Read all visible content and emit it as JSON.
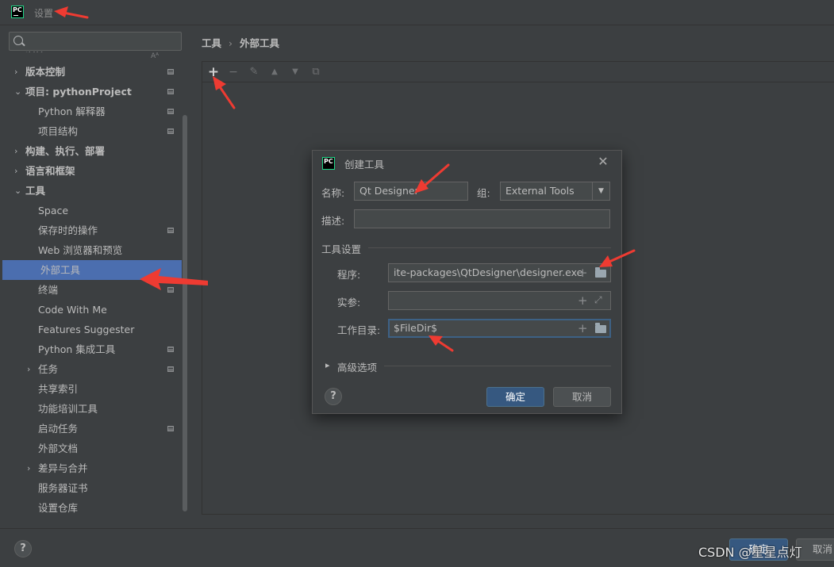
{
  "window": {
    "logo_text": "PC",
    "title": "设置"
  },
  "search": {
    "placeholder": "",
    "value": ""
  },
  "sidebar": {
    "items": [
      {
        "label": "插件",
        "level": 0,
        "expander": "",
        "badge": false,
        "cut": true
      },
      {
        "label": "版本控制",
        "level": 0,
        "expander": "›",
        "badge": true
      },
      {
        "label": "项目: pythonProject",
        "level": 0,
        "expander": "⌄",
        "badge": true
      },
      {
        "label": "Python 解释器",
        "level": 1,
        "expander": "",
        "badge": true
      },
      {
        "label": "项目结构",
        "level": 1,
        "expander": "",
        "badge": true
      },
      {
        "label": "构建、执行、部署",
        "level": 0,
        "expander": "›",
        "badge": false
      },
      {
        "label": "语言和框架",
        "level": 0,
        "expander": "›",
        "badge": false
      },
      {
        "label": "工具",
        "level": 0,
        "expander": "⌄",
        "badge": false
      },
      {
        "label": "Space",
        "level": 1,
        "expander": "",
        "badge": false
      },
      {
        "label": "保存时的操作",
        "level": 1,
        "expander": "",
        "badge": true
      },
      {
        "label": "Web 浏览器和预览",
        "level": 1,
        "expander": "",
        "badge": false
      },
      {
        "label": "外部工具",
        "level": 1,
        "expander": "",
        "badge": false,
        "selected": true
      },
      {
        "label": "终端",
        "level": 1,
        "expander": "",
        "badge": true
      },
      {
        "label": "Code With Me",
        "level": 1,
        "expander": "",
        "badge": false
      },
      {
        "label": "Features Suggester",
        "level": 1,
        "expander": "",
        "badge": false
      },
      {
        "label": "Python 集成工具",
        "level": 1,
        "expander": "",
        "badge": true
      },
      {
        "label": "任务",
        "level": 1,
        "expander": "›",
        "badge": true
      },
      {
        "label": "共享索引",
        "level": 1,
        "expander": "",
        "badge": false
      },
      {
        "label": "功能培训工具",
        "level": 1,
        "expander": "",
        "badge": false
      },
      {
        "label": "启动任务",
        "level": 1,
        "expander": "",
        "badge": true
      },
      {
        "label": "外部文档",
        "level": 1,
        "expander": "",
        "badge": false
      },
      {
        "label": "差异与合并",
        "level": 1,
        "expander": "›",
        "badge": false
      },
      {
        "label": "服务器证书",
        "level": 1,
        "expander": "",
        "badge": false
      },
      {
        "label": "设置仓库",
        "level": 1,
        "expander": "",
        "badge": false
      }
    ]
  },
  "breadcrumb": {
    "parent": "工具",
    "separator": "›",
    "current": "外部工具"
  },
  "toolbar": {
    "add": "+",
    "remove": "−",
    "edit": "✎",
    "up": "▲",
    "down": "▼",
    "copy": "⧉"
  },
  "dialog": {
    "logo_text": "PC",
    "title": "创建工具",
    "close": "✕",
    "name_label": "名称:",
    "name_value": "Qt Designer",
    "group_label": "组:",
    "group_value": "External Tools",
    "description_label": "描述:",
    "description_value": "",
    "section_title": "工具设置",
    "program_label": "程序:",
    "program_value": "ite-packages\\QtDesigner\\designer.exe",
    "args_label": "实参:",
    "args_value": "",
    "workdir_label": "工作目录:",
    "workdir_value": "$FileDir$",
    "advanced_label": "高级选项",
    "help": "?",
    "ok_label": "确定",
    "cancel_label": "取消",
    "plus": "+",
    "dropdown": "▼",
    "expander": "▸"
  },
  "bottom": {
    "help": "?",
    "ok_label": "确定",
    "cancel_label": "取消"
  },
  "watermark": "CSDN @星星点灯",
  "colors": {
    "selection": "#4b6eaf",
    "primary_button": "#365880",
    "annotation_arrow": "#ee3b32"
  }
}
